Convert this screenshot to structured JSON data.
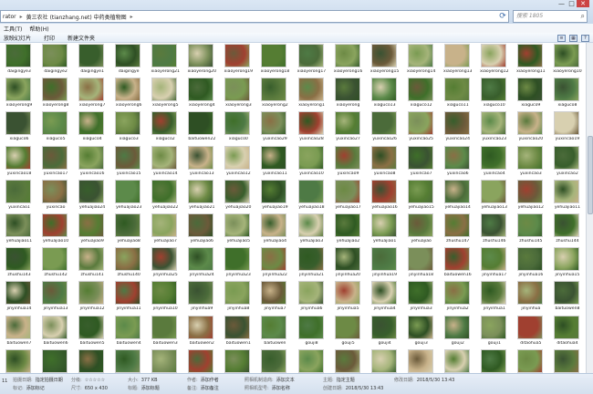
{
  "titlebar": {
    "address_segments": [
      "rator",
      "▸",
      "黄三农社 (tianzhang.net) 中药类植物图",
      "▸"
    ],
    "search_placeholder": "搜索 1805",
    "window_buttons": [
      "—",
      "□",
      "✕"
    ]
  },
  "menu": [
    "工具(T)",
    "帮助(H)"
  ],
  "toolbar": {
    "items": [
      "放映幻灯片",
      "打印",
      "新建文件夹"
    ]
  },
  "view_buttons": [
    "≡",
    "▦",
    "?"
  ],
  "colors": {
    "accent": "#3b6aa8",
    "chrome": "#dbe7f4"
  },
  "thumbnail_colors": [
    "#3f6f2a",
    "#557d33",
    "#2f5a22",
    "#6d8a45",
    "#4b6b3a",
    "#7a9b52",
    "#385e2c",
    "#8aa45e",
    "#5a7a3d",
    "#2e4f24",
    "#6b5a3a",
    "#8a6f45",
    "#4e7a45",
    "#a5b47a",
    "#3a5232",
    "#7b8f5a",
    "#c8b28a",
    "#5c8a4a",
    "#a04030",
    "#d8d0b0"
  ],
  "files": [
    [
      "daigingye3",
      "daigingye2",
      "daigingye1",
      "daigingye",
      "xiaoyerong21",
      "xiaoyerong20",
      "xiaoyerong19",
      "xiaoyerong18",
      "xiaoyerong17",
      "xiaoyerong16",
      "xiaoyerong15",
      "xiaoyerong14",
      "xiaoyerong13",
      "xiaoyerong12",
      "xiaoyerong11",
      "xiaoyerong10"
    ],
    [
      "xiaoyerong9",
      "xiaoyerong8",
      "xiaoyerong7",
      "xiaoyerong6",
      "xiaoyerong5",
      "xiaoyerong4",
      "xiaoyerong3",
      "xiaoyerong2",
      "xiaoyerong1",
      "xiaoyerong",
      "xiaguco13",
      "xiaguco12",
      "xiaguco11",
      "xiaguco10",
      "xiaguco9",
      "xiaguco8"
    ],
    [
      "xiaguco6",
      "xiaguco5",
      "xiaguco4",
      "xiaguco3",
      "xiaguco2",
      "baituowen22",
      "xiaguco0",
      "yuxincao29",
      "yuxincao28",
      "yuxincao27",
      "yuxincao26",
      "yuxincao25",
      "yuxincao24",
      "yuxincao23",
      "yuxincao20",
      "yuxincao19"
    ],
    [
      "yuxincao18",
      "yuxincao17",
      "yuxincao16",
      "yuxincao15",
      "yuxincao14",
      "yuxincao13",
      "yuxincao12",
      "yuxincao11",
      "yuxincao10",
      "yuxincao9",
      "yuxincao8",
      "yuxincao7",
      "yuxincao6",
      "yuxincao4",
      "yuxincao3",
      "yuxincao2"
    ],
    [
      "yuxincao1",
      "yuxincao",
      "yehuajiao24",
      "yehuajiao23",
      "yehuajiao22",
      "yehuajiao21",
      "yehuajiao20",
      "yehuajiao19",
      "yehuajiao18",
      "yehuajiao17",
      "yehuajiao16",
      "yehuajiao15",
      "yehuajiao14",
      "yehuajiao13",
      "yehuajiao12",
      "yehuajiao11"
    ],
    [
      "yehuajiao11",
      "yehuajiao10",
      "yehuajiao9",
      "yehuajiao8",
      "yehuajiao7",
      "yehuajiao6",
      "yehuajiao5",
      "yehuajiao4",
      "yehuajiao3",
      "yehuajiao2",
      "yehuajiao1",
      "yehuajiao",
      "zhushu147",
      "zhushu146",
      "zhushu145",
      "zhushu144"
    ],
    [
      "zhushu143",
      "zhushu142",
      "zhushu141",
      "zhushu140",
      "jinyinhua25",
      "jinyinhua24",
      "jinyinhua23",
      "jinyinhua22",
      "jinyinhua21",
      "jinyinhua20",
      "jinyinhua19",
      "jinyinhua18",
      "baituowen16",
      "jinyinhua17",
      "jinyinhua16",
      "jinyinhua15"
    ],
    [
      "jinyinhua14",
      "jinyinhua13",
      "jinyinhua12",
      "jinyinhua11",
      "jinyinhua10",
      "jinyinhua9",
      "jinyinhua8",
      "jinyinhua7",
      "jinyinhua6",
      "jinyinhua5",
      "jinyinhua4",
      "jinyinhua3",
      "jinyinhua2",
      "jinyinhua1",
      "jinyinhua",
      "baituowen8"
    ],
    [
      "baituowen7",
      "baituowen6",
      "baituowen5",
      "baituowen4",
      "baituowen3",
      "baituowen2",
      "baituowen1",
      "baituowen",
      "gouji8",
      "gouji5",
      "gouji4",
      "gouji3",
      "gouji2",
      "gouji1",
      "ditaohua5",
      "ditaohua4"
    ],
    [
      "",
      "",
      "",
      "",
      "",
      "",
      "",
      "",
      "",
      "",
      "",
      "",
      "",
      "",
      "",
      ""
    ]
  ],
  "status": {
    "count": "11",
    "fields": [
      {
        "k": "拍摄日期:",
        "v": "指定拍摄日期"
      },
      {
        "k": "标记:",
        "v": "添加标记"
      },
      {
        "k": "分级:",
        "v": "☆☆☆☆☆"
      },
      {
        "k": "尺寸:",
        "v": "650 x 430"
      },
      {
        "k": "大小:",
        "v": "377 KB"
      },
      {
        "k": "标题:",
        "v": "添加标题"
      },
      {
        "k": "作者:",
        "v": "添加作者"
      },
      {
        "k": "备注:",
        "v": "添加备注"
      },
      {
        "k": "照相机制造商:",
        "v": "添加文本"
      },
      {
        "k": "照相机型号:",
        "v": "添加名称"
      },
      {
        "k": "主题:",
        "v": "指定主题"
      },
      {
        "k": "创建日期:",
        "v": "2018/5/30 13:43"
      },
      {
        "k": "修改日期:",
        "v": "2018/5/30 13:43"
      }
    ]
  }
}
